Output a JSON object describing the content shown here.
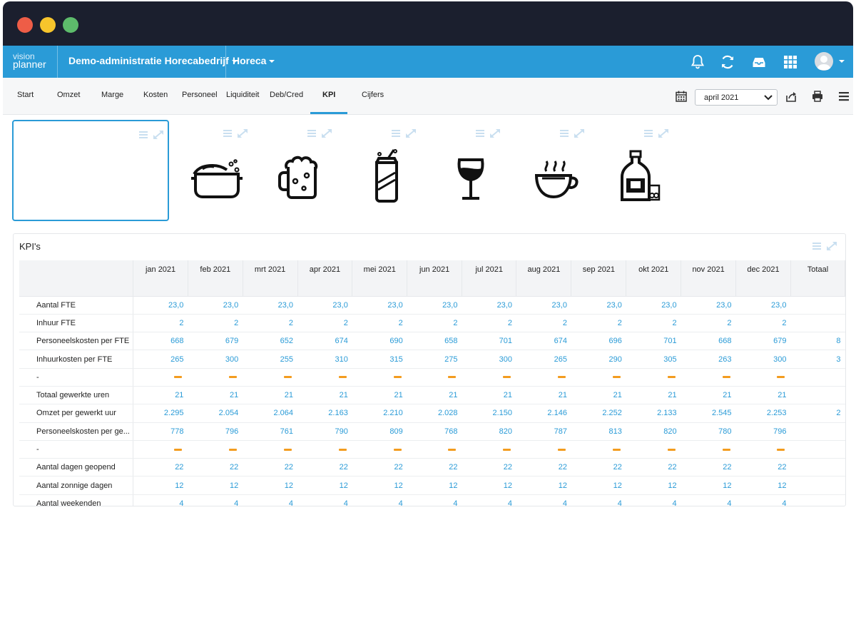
{
  "window": {
    "dots": [
      "close",
      "minimize",
      "maximize"
    ]
  },
  "appbar": {
    "logo_line1": "vision",
    "logo_line2": "planner",
    "administration": "Demo-administratie Horecabedrijf",
    "module": "Horeca",
    "icons": [
      "bell-icon",
      "refresh-icon",
      "inbox-icon",
      "apps-grid-icon"
    ],
    "accent": "#2a9bd7"
  },
  "nav": {
    "items": [
      "Start",
      "Omzet",
      "Marge",
      "Kosten",
      "Personeel",
      "Liquiditeit",
      "Deb/Cred",
      "KPI",
      "Cijfers"
    ],
    "active": "KPI",
    "period": "april 2021"
  },
  "widgets": [
    "blank",
    "pot",
    "beer",
    "soda-can",
    "wine-glass",
    "coffee-cup",
    "liquor-bottle"
  ],
  "kpi": {
    "title": "KPI's",
    "columns": [
      "jan 2021",
      "feb 2021",
      "mrt 2021",
      "apr 2021",
      "mei 2021",
      "jun 2021",
      "jul 2021",
      "aug 2021",
      "sep 2021",
      "okt 2021",
      "nov 2021",
      "dec 2021",
      "Totaal"
    ],
    "rows": [
      {
        "label": "Aantal FTE",
        "values": [
          "23,0",
          "23,0",
          "23,0",
          "23,0",
          "23,0",
          "23,0",
          "23,0",
          "23,0",
          "23,0",
          "23,0",
          "23,0",
          "23,0",
          ""
        ]
      },
      {
        "label": "Inhuur FTE",
        "values": [
          "2",
          "2",
          "2",
          "2",
          "2",
          "2",
          "2",
          "2",
          "2",
          "2",
          "2",
          "2",
          ""
        ]
      },
      {
        "label": "Personeelskosten per FTE",
        "values": [
          "668",
          "679",
          "652",
          "674",
          "690",
          "658",
          "701",
          "674",
          "696",
          "701",
          "668",
          "679",
          "8"
        ]
      },
      {
        "label": "Inhuurkosten per FTE",
        "values": [
          "265",
          "300",
          "255",
          "310",
          "315",
          "275",
          "300",
          "265",
          "290",
          "305",
          "263",
          "300",
          "3"
        ]
      },
      {
        "label": "-",
        "dash": true
      },
      {
        "label": "Totaal gewerkte uren",
        "values": [
          "21",
          "21",
          "21",
          "21",
          "21",
          "21",
          "21",
          "21",
          "21",
          "21",
          "21",
          "21",
          ""
        ]
      },
      {
        "label": "Omzet per gewerkt uur",
        "values": [
          "2.295",
          "2.054",
          "2.064",
          "2.163",
          "2.210",
          "2.028",
          "2.150",
          "2.146",
          "2.252",
          "2.133",
          "2.545",
          "2.253",
          "2"
        ]
      },
      {
        "label": "Personeelskosten per ge...",
        "values": [
          "778",
          "796",
          "761",
          "790",
          "809",
          "768",
          "820",
          "787",
          "813",
          "820",
          "780",
          "796",
          ""
        ]
      },
      {
        "label": "-",
        "dash": true
      },
      {
        "label": "Aantal dagen geopend",
        "values": [
          "22",
          "22",
          "22",
          "22",
          "22",
          "22",
          "22",
          "22",
          "22",
          "22",
          "22",
          "22",
          ""
        ]
      },
      {
        "label": "Aantal zonnige dagen",
        "values": [
          "12",
          "12",
          "12",
          "12",
          "12",
          "12",
          "12",
          "12",
          "12",
          "12",
          "12",
          "12",
          ""
        ]
      },
      {
        "label": "Aantal weekenden",
        "values": [
          "4",
          "4",
          "4",
          "4",
          "4",
          "4",
          "4",
          "4",
          "4",
          "4",
          "4",
          "4",
          ""
        ]
      }
    ],
    "value_color": "#2a9bd7",
    "dash_color": "#f39c1f"
  }
}
